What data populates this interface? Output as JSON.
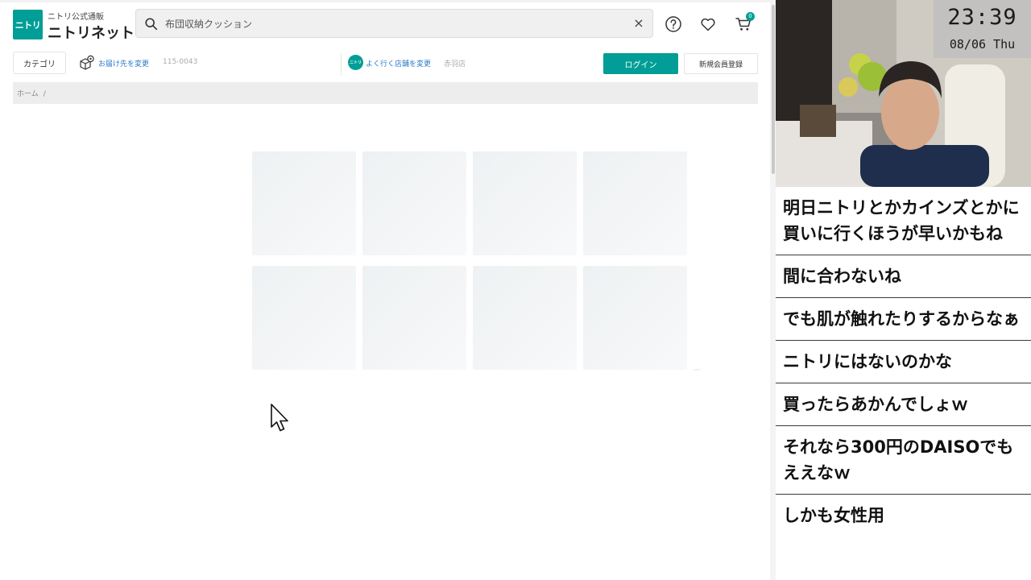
{
  "site": {
    "logo_mark": "ニトリ",
    "logo_sub": "ニトリ公式通販",
    "logo_main": "ニトリネット",
    "search": {
      "value": "布団収納クッション",
      "clear_symbol": "×"
    },
    "cart_count": "0",
    "category_label": "カテゴリ",
    "delivery_link": "お届け先を変更",
    "postal_code": "115-0043",
    "store_mark": "ニトリ",
    "store_link": "よく行く店舗を変更",
    "store_name": "赤羽店",
    "login_label": "ログイン",
    "register_label": "新規会員登録",
    "breadcrumb": {
      "home": "ホーム",
      "separator": "/"
    },
    "more_dots": "···",
    "colors": {
      "brand": "#009e96",
      "link": "#2a7cc7"
    }
  },
  "overlay": {
    "clock": {
      "time": "23:39",
      "date": "08/06 Thu"
    },
    "comments": [
      "明日ニトリとかカインズとかに買いに行くほうが早いかもね",
      "間に合わないね",
      "でも肌が触れたりするからなぁ",
      "ニトリにはないのかな",
      "買ったらあかんでしょｗ",
      "それなら300円のDAISOでもええなｗ",
      "しかも女性用"
    ]
  }
}
